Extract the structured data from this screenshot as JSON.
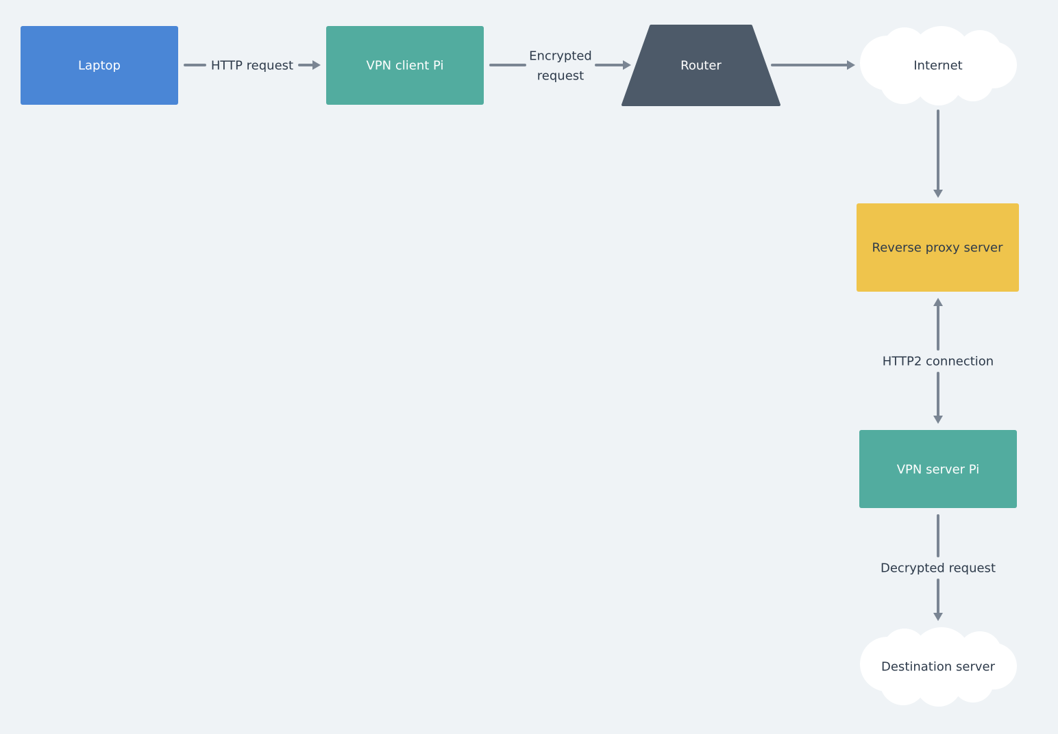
{
  "colors": {
    "background": "#eff3f6",
    "laptop": "#4a86d6",
    "vpn_pi": "#52ac9f",
    "router": "#4d5a69",
    "proxy": "#efc44c",
    "cloud": "#ffffff",
    "edge": "#7a8593",
    "text_dark": "#2d3a4a",
    "text_light": "#ffffff"
  },
  "nodes": {
    "laptop": {
      "label": "Laptop",
      "shape": "rectangle"
    },
    "vpn_client_pi": {
      "label": "VPN client Pi",
      "shape": "rectangle"
    },
    "router": {
      "label": "Router",
      "shape": "trapezoid"
    },
    "internet": {
      "label": "Internet",
      "shape": "cloud"
    },
    "reverse_proxy_server": {
      "label": "Reverse proxy server",
      "shape": "rectangle"
    },
    "vpn_server_pi": {
      "label": "VPN server Pi",
      "shape": "rectangle"
    },
    "destination_server": {
      "label": "Destination server",
      "shape": "cloud"
    }
  },
  "edges": {
    "laptop_to_vpn_client": {
      "from": "Laptop",
      "to": "VPN client Pi",
      "label": "HTTP request"
    },
    "vpn_client_to_router": {
      "from": "VPN client Pi",
      "to": "Router",
      "label_line1": "Encrypted",
      "label_line2": "request"
    },
    "router_to_internet": {
      "from": "Router",
      "to": "Internet",
      "label": ""
    },
    "internet_to_proxy": {
      "from": "Internet",
      "to": "Reverse proxy server",
      "label": ""
    },
    "proxy_to_vpn_server": {
      "from": "Reverse proxy server",
      "to": "VPN server Pi",
      "label": "HTTP2 connection",
      "bidirectional": true
    },
    "vpn_server_to_destination": {
      "from": "VPN server Pi",
      "to": "Destination server",
      "label": "Decrypted request"
    }
  }
}
